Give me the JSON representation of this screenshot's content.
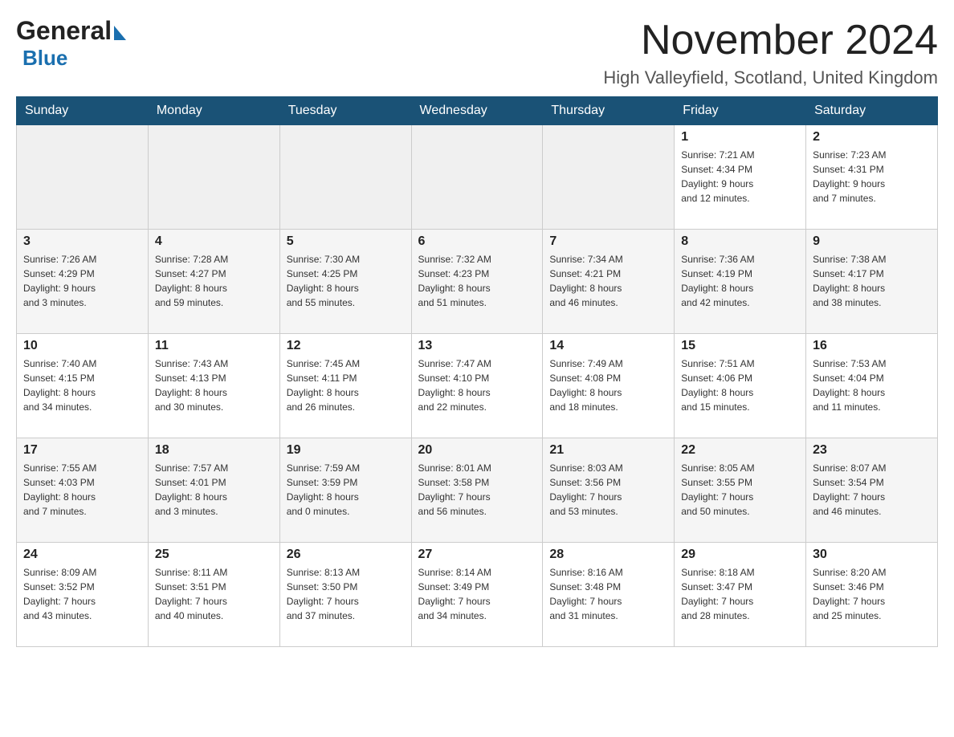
{
  "header": {
    "logo_general": "General",
    "logo_blue": "Blue",
    "month_title": "November 2024",
    "location": "High Valleyfield, Scotland, United Kingdom"
  },
  "weekdays": [
    "Sunday",
    "Monday",
    "Tuesday",
    "Wednesday",
    "Thursday",
    "Friday",
    "Saturday"
  ],
  "weeks": [
    [
      {
        "day": "",
        "info": ""
      },
      {
        "day": "",
        "info": ""
      },
      {
        "day": "",
        "info": ""
      },
      {
        "day": "",
        "info": ""
      },
      {
        "day": "",
        "info": ""
      },
      {
        "day": "1",
        "info": "Sunrise: 7:21 AM\nSunset: 4:34 PM\nDaylight: 9 hours\nand 12 minutes."
      },
      {
        "day": "2",
        "info": "Sunrise: 7:23 AM\nSunset: 4:31 PM\nDaylight: 9 hours\nand 7 minutes."
      }
    ],
    [
      {
        "day": "3",
        "info": "Sunrise: 7:26 AM\nSunset: 4:29 PM\nDaylight: 9 hours\nand 3 minutes."
      },
      {
        "day": "4",
        "info": "Sunrise: 7:28 AM\nSunset: 4:27 PM\nDaylight: 8 hours\nand 59 minutes."
      },
      {
        "day": "5",
        "info": "Sunrise: 7:30 AM\nSunset: 4:25 PM\nDaylight: 8 hours\nand 55 minutes."
      },
      {
        "day": "6",
        "info": "Sunrise: 7:32 AM\nSunset: 4:23 PM\nDaylight: 8 hours\nand 51 minutes."
      },
      {
        "day": "7",
        "info": "Sunrise: 7:34 AM\nSunset: 4:21 PM\nDaylight: 8 hours\nand 46 minutes."
      },
      {
        "day": "8",
        "info": "Sunrise: 7:36 AM\nSunset: 4:19 PM\nDaylight: 8 hours\nand 42 minutes."
      },
      {
        "day": "9",
        "info": "Sunrise: 7:38 AM\nSunset: 4:17 PM\nDaylight: 8 hours\nand 38 minutes."
      }
    ],
    [
      {
        "day": "10",
        "info": "Sunrise: 7:40 AM\nSunset: 4:15 PM\nDaylight: 8 hours\nand 34 minutes."
      },
      {
        "day": "11",
        "info": "Sunrise: 7:43 AM\nSunset: 4:13 PM\nDaylight: 8 hours\nand 30 minutes."
      },
      {
        "day": "12",
        "info": "Sunrise: 7:45 AM\nSunset: 4:11 PM\nDaylight: 8 hours\nand 26 minutes."
      },
      {
        "day": "13",
        "info": "Sunrise: 7:47 AM\nSunset: 4:10 PM\nDaylight: 8 hours\nand 22 minutes."
      },
      {
        "day": "14",
        "info": "Sunrise: 7:49 AM\nSunset: 4:08 PM\nDaylight: 8 hours\nand 18 minutes."
      },
      {
        "day": "15",
        "info": "Sunrise: 7:51 AM\nSunset: 4:06 PM\nDaylight: 8 hours\nand 15 minutes."
      },
      {
        "day": "16",
        "info": "Sunrise: 7:53 AM\nSunset: 4:04 PM\nDaylight: 8 hours\nand 11 minutes."
      }
    ],
    [
      {
        "day": "17",
        "info": "Sunrise: 7:55 AM\nSunset: 4:03 PM\nDaylight: 8 hours\nand 7 minutes."
      },
      {
        "day": "18",
        "info": "Sunrise: 7:57 AM\nSunset: 4:01 PM\nDaylight: 8 hours\nand 3 minutes."
      },
      {
        "day": "19",
        "info": "Sunrise: 7:59 AM\nSunset: 3:59 PM\nDaylight: 8 hours\nand 0 minutes."
      },
      {
        "day": "20",
        "info": "Sunrise: 8:01 AM\nSunset: 3:58 PM\nDaylight: 7 hours\nand 56 minutes."
      },
      {
        "day": "21",
        "info": "Sunrise: 8:03 AM\nSunset: 3:56 PM\nDaylight: 7 hours\nand 53 minutes."
      },
      {
        "day": "22",
        "info": "Sunrise: 8:05 AM\nSunset: 3:55 PM\nDaylight: 7 hours\nand 50 minutes."
      },
      {
        "day": "23",
        "info": "Sunrise: 8:07 AM\nSunset: 3:54 PM\nDaylight: 7 hours\nand 46 minutes."
      }
    ],
    [
      {
        "day": "24",
        "info": "Sunrise: 8:09 AM\nSunset: 3:52 PM\nDaylight: 7 hours\nand 43 minutes."
      },
      {
        "day": "25",
        "info": "Sunrise: 8:11 AM\nSunset: 3:51 PM\nDaylight: 7 hours\nand 40 minutes."
      },
      {
        "day": "26",
        "info": "Sunrise: 8:13 AM\nSunset: 3:50 PM\nDaylight: 7 hours\nand 37 minutes."
      },
      {
        "day": "27",
        "info": "Sunrise: 8:14 AM\nSunset: 3:49 PM\nDaylight: 7 hours\nand 34 minutes."
      },
      {
        "day": "28",
        "info": "Sunrise: 8:16 AM\nSunset: 3:48 PM\nDaylight: 7 hours\nand 31 minutes."
      },
      {
        "day": "29",
        "info": "Sunrise: 8:18 AM\nSunset: 3:47 PM\nDaylight: 7 hours\nand 28 minutes."
      },
      {
        "day": "30",
        "info": "Sunrise: 8:20 AM\nSunset: 3:46 PM\nDaylight: 7 hours\nand 25 minutes."
      }
    ]
  ]
}
